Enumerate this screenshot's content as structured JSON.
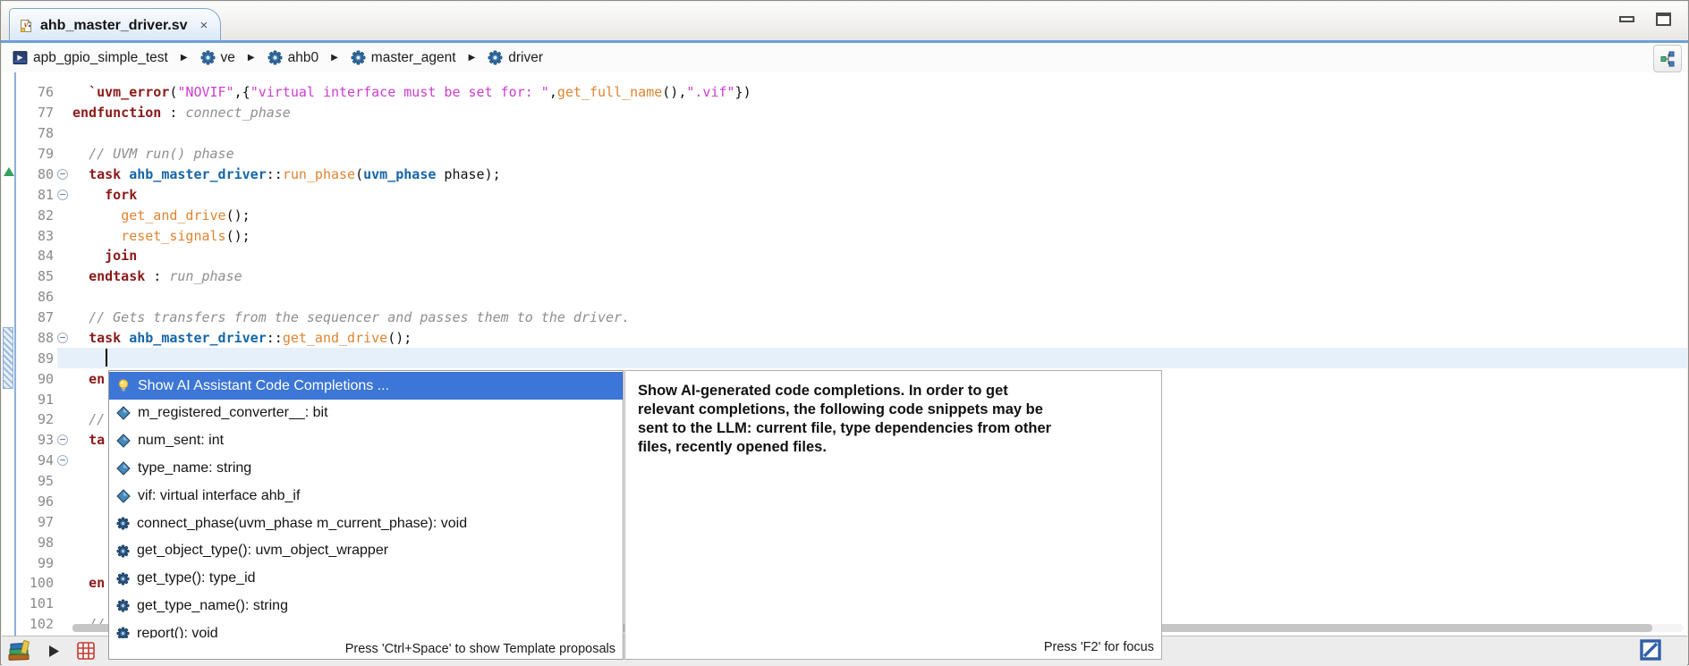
{
  "window": {
    "buttons": [
      "minimize",
      "maximize"
    ],
    "accent_color": "#6f9fd8",
    "selection_color": "#3c76d6"
  },
  "tab": {
    "title": "ahb_master_driver.sv",
    "close": "×"
  },
  "breadcrumb": {
    "separator": "▶",
    "items": [
      {
        "icon": "project",
        "label": "apb_gpio_simple_test"
      },
      {
        "icon": "uvm-component",
        "label": "ve"
      },
      {
        "icon": "uvm-component",
        "label": "ahb0"
      },
      {
        "icon": "uvm-component",
        "label": "master_agent"
      },
      {
        "icon": "uvm-component",
        "label": "driver"
      }
    ]
  },
  "editor": {
    "markers": {
      "arrow_line": 80,
      "change_lines": [
        88,
        90
      ]
    },
    "lines": [
      {
        "n": 76,
        "segs": [
          [
            "t",
            "  "
          ],
          [
            "k",
            "`uvm_error"
          ],
          [
            "t",
            "("
          ],
          [
            "s",
            "\"NOVIF\""
          ],
          [
            "t",
            ",{"
          ],
          [
            "s",
            "\"virtual interface must be set for: \""
          ],
          [
            "t",
            ","
          ],
          [
            "f",
            "get_full_name"
          ],
          [
            "t",
            "(),"
          ],
          [
            "s",
            "\".vif\""
          ],
          [
            "t",
            "})"
          ]
        ]
      },
      {
        "n": 77,
        "segs": [
          [
            "k",
            "endfunction"
          ],
          [
            "t",
            " : "
          ],
          [
            "l",
            "connect_phase"
          ]
        ]
      },
      {
        "n": 78,
        "segs": []
      },
      {
        "n": 79,
        "segs": [
          [
            "t",
            "  "
          ],
          [
            "c",
            "// UVM run() phase"
          ]
        ]
      },
      {
        "n": 80,
        "fold": true,
        "segs": [
          [
            "t",
            "  "
          ],
          [
            "k",
            "task"
          ],
          [
            "t",
            " "
          ],
          [
            "cl",
            "ahb_master_driver"
          ],
          [
            "t",
            "::"
          ],
          [
            "f",
            "run_phase"
          ],
          [
            "t",
            "("
          ],
          [
            "ty",
            "uvm_phase"
          ],
          [
            "t",
            " phase);"
          ]
        ]
      },
      {
        "n": 81,
        "fold": true,
        "segs": [
          [
            "t",
            "    "
          ],
          [
            "k",
            "fork"
          ]
        ]
      },
      {
        "n": 82,
        "segs": [
          [
            "t",
            "      "
          ],
          [
            "f",
            "get_and_drive"
          ],
          [
            "t",
            "();"
          ]
        ]
      },
      {
        "n": 83,
        "segs": [
          [
            "t",
            "      "
          ],
          [
            "f",
            "reset_signals"
          ],
          [
            "t",
            "();"
          ]
        ]
      },
      {
        "n": 84,
        "segs": [
          [
            "t",
            "    "
          ],
          [
            "k",
            "join"
          ]
        ]
      },
      {
        "n": 85,
        "segs": [
          [
            "t",
            "  "
          ],
          [
            "k",
            "endtask"
          ],
          [
            "t",
            " : "
          ],
          [
            "l",
            "run_phase"
          ]
        ]
      },
      {
        "n": 86,
        "segs": []
      },
      {
        "n": 87,
        "segs": [
          [
            "t",
            "  "
          ],
          [
            "c",
            "// Gets transfers from the sequencer and passes them to the driver."
          ]
        ]
      },
      {
        "n": 88,
        "fold": true,
        "segs": [
          [
            "t",
            "  "
          ],
          [
            "k",
            "task"
          ],
          [
            "t",
            " "
          ],
          [
            "cl",
            "ahb_master_driver"
          ],
          [
            "t",
            "::"
          ],
          [
            "f",
            "get_and_drive"
          ],
          [
            "t",
            "();"
          ]
        ]
      },
      {
        "n": 89,
        "cur": true,
        "segs": []
      },
      {
        "n": 90,
        "segs": [
          [
            "t",
            "  "
          ],
          [
            "k",
            "en"
          ]
        ]
      },
      {
        "n": 91,
        "segs": []
      },
      {
        "n": 92,
        "segs": [
          [
            "t",
            "  "
          ],
          [
            "c",
            "//"
          ]
        ]
      },
      {
        "n": 93,
        "fold": true,
        "segs": [
          [
            "t",
            "  "
          ],
          [
            "k",
            "ta"
          ]
        ]
      },
      {
        "n": 94,
        "fold": true,
        "segs": []
      },
      {
        "n": 95,
        "segs": []
      },
      {
        "n": 96,
        "segs": []
      },
      {
        "n": 97,
        "segs": []
      },
      {
        "n": 98,
        "segs": []
      },
      {
        "n": 99,
        "segs": []
      },
      {
        "n": 100,
        "segs": [
          [
            "t",
            "  "
          ],
          [
            "k",
            "en"
          ]
        ]
      },
      {
        "n": 101,
        "segs": []
      },
      {
        "n": 102,
        "segs": [
          [
            "t",
            "  "
          ],
          [
            "c",
            "//"
          ]
        ]
      }
    ]
  },
  "completion": {
    "selected": {
      "icon": "lightbulb",
      "label": "Show AI Assistant Code Completions ..."
    },
    "items": [
      {
        "icon": "field",
        "label": "m_registered_converter__: bit"
      },
      {
        "icon": "field",
        "label": "num_sent: int"
      },
      {
        "icon": "field",
        "label": "type_name: string"
      },
      {
        "icon": "field",
        "label": "vif: virtual interface ahb_if"
      },
      {
        "icon": "method",
        "label": "connect_phase(uvm_phase m_current_phase): void"
      },
      {
        "icon": "method",
        "label": "get_object_type(): uvm_object_wrapper"
      },
      {
        "icon": "method",
        "label": "get_type(): type_id"
      },
      {
        "icon": "method",
        "label": "get_type_name(): string"
      },
      {
        "icon": "method",
        "label": "report(): void"
      }
    ],
    "footer": "Press 'Ctrl+Space' to show Template proposals"
  },
  "tooltip": {
    "lines": [
      "Show AI-generated code completions. In order to get",
      "relevant completions, the following code snippets may be",
      "sent to the LLM: current file, type dependencies from other",
      "files, recently opened files."
    ],
    "footer": "Press 'F2' for focus"
  },
  "statusbar": {
    "left_icons": [
      "library",
      "play",
      "red-grid"
    ],
    "right_icons": [
      "blue-diagonal"
    ]
  }
}
